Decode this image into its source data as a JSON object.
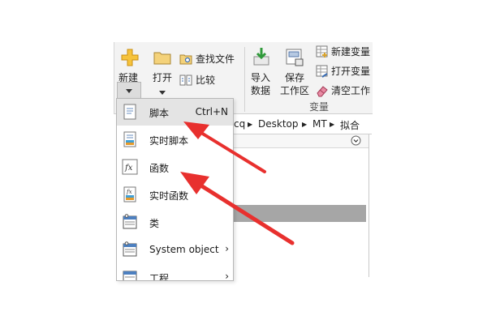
{
  "ribbon": {
    "new_label": "新建",
    "open_label": "打开",
    "find_files_label": "查找文件",
    "compare_label": "比较",
    "import_label_line1": "导入",
    "import_label_line2": "数据",
    "save_ws_label_line1": "保存",
    "save_ws_label_line2": "工作区",
    "new_var_label": "新建变量",
    "open_var_label": "打开变量",
    "clear_ws_label": "清空工作",
    "variable_section_label": "变量"
  },
  "address": {
    "seg1": "cq",
    "seg2": "Desktop",
    "seg3": "MT",
    "seg4": "拟合",
    "sep": "▶"
  },
  "menu": {
    "items": [
      {
        "label": "脚本",
        "shortcut": "Ctrl+N",
        "icon": "script-icon"
      },
      {
        "label": "实时脚本",
        "icon": "live-script-icon"
      },
      {
        "label": "函数",
        "icon": "function-icon"
      },
      {
        "label": "实时函数",
        "icon": "live-function-icon"
      },
      {
        "label": "类",
        "icon": "class-icon"
      },
      {
        "label": "System object",
        "submenu": "›",
        "icon": "system-object-icon"
      },
      {
        "label": "工程",
        "submenu": "›",
        "icon": "project-icon"
      }
    ]
  },
  "colors": {
    "annotation_arrow": "#e8302e",
    "ribbon_bg": "#f3f3f3",
    "selected_row": "#a6a6a6"
  }
}
